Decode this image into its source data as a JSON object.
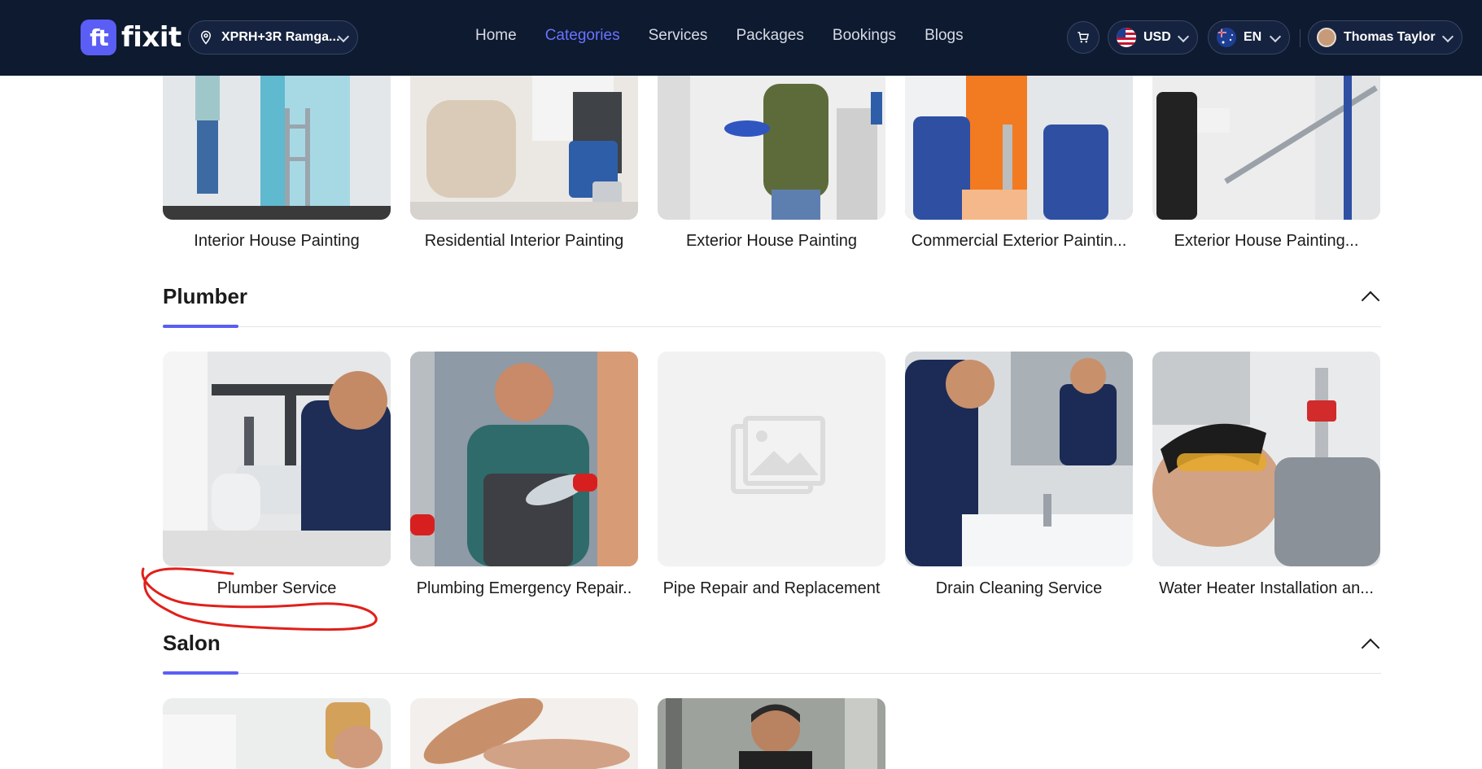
{
  "header": {
    "logo_mark": "ft",
    "logo_text": "fixit",
    "location": "XPRH+3R Ramga...",
    "nav": [
      "Home",
      "Categories",
      "Services",
      "Packages",
      "Bookings",
      "Blogs"
    ],
    "active_nav": "Categories",
    "currency": "USD",
    "language": "EN",
    "user_name": "Thomas Taylor"
  },
  "painting_services": [
    "Interior House Painting",
    "Residential Interior Painting",
    "Exterior House Painting",
    "Commercial Exterior Paintin...",
    "Exterior House Painting..."
  ],
  "plumber": {
    "title": "Plumber",
    "services": [
      "Plumber Service",
      "Plumbing Emergency Repair..",
      "Pipe Repair and Replacement",
      "Drain Cleaning Service",
      "Water Heater Installation an..."
    ]
  },
  "salon": {
    "title": "Salon"
  },
  "colors": {
    "header_bg": "#0d1a30",
    "accent": "#5a5ef5",
    "active_nav": "#6b72ff",
    "annotation": "#e0201b"
  }
}
